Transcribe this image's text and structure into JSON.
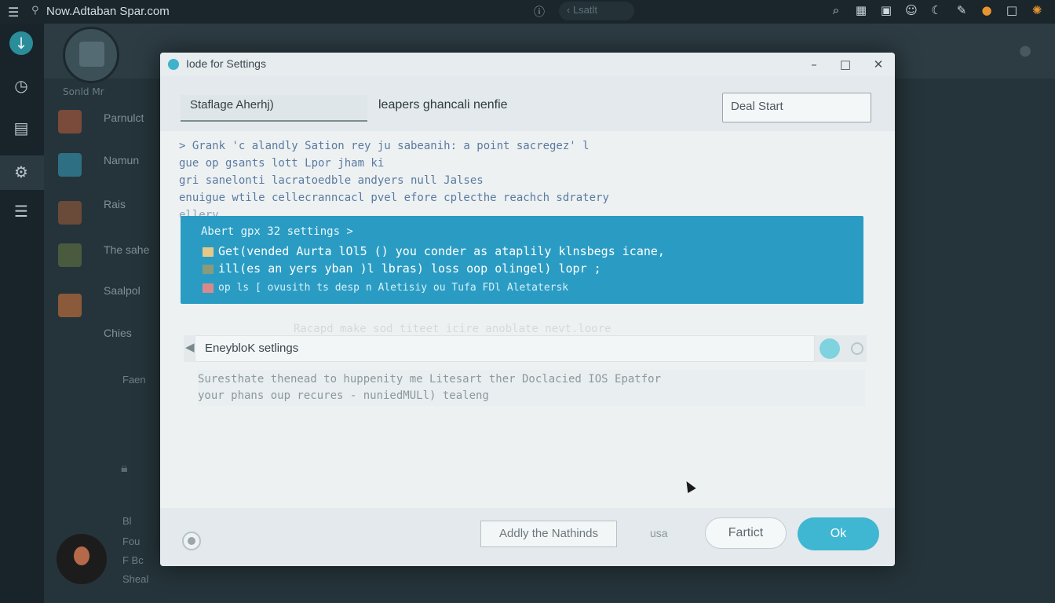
{
  "topbar": {
    "title": "Now.Adtaban Spar.com",
    "back_label": "Lsatlt",
    "icons": [
      "menu-icon",
      "pin-icon",
      "info-icon",
      "search-icon",
      "grid-icon",
      "lock-icon",
      "smile-icon",
      "moon-icon",
      "brush-icon",
      "avatar-icon",
      "square-icon",
      "logo-icon"
    ]
  },
  "rail": {
    "icons": [
      "download-icon",
      "clock-icon",
      "book-icon",
      "tools-icon",
      "list-icon"
    ]
  },
  "background_app": {
    "subtitle": "Sonld Mr",
    "list": [
      "Parnulct",
      "Namun",
      "Rais",
      "The sahe",
      "Saalpol",
      "Chies"
    ],
    "side_notes": [
      "Bl",
      "Fou",
      "F Bc",
      "Sheal"
    ],
    "misc_note": "Faen"
  },
  "dialog": {
    "title": "Iode for Settings",
    "tabs": [
      "Staflage Aherhj)",
      "leapers ghancali nenfie"
    ],
    "search_value": "Deal Start",
    "description": [
      "> Grank 'c alandly Sation rey ju sabeanih: a point sacregez' l",
      "gue op gsants lott Lpor jham ki",
      "gri sanelonti lacratoedble andyers null Jalses",
      "enuigue wtile cellecranncacl pvel efore cplecthe reachch sdratery",
      "ellery"
    ],
    "banner": {
      "heading": "Abert gpx 32 settings >",
      "lines": [
        "Get(vended Aurta lOl5 () you conder as ataplily klnsbegs icane,",
        "ill(es an yers yban )l lbras) loss oop olingel) lopr ;",
        "op ls [ ovusith ts desp n Aletisiy ou Tufa  FDl  Aletatersk"
      ]
    },
    "ghost_hint": "Racapd make sod titeet icire anoblate nevt.loore",
    "setting": {
      "label": "EneybloK setlings"
    },
    "help": [
      "Suresthate thenead to huppenity me Litesart ther Doclacied IOS Epatfor",
      "your phans oup recures - nuniedMULl) tealeng"
    ],
    "footer": {
      "additional_label": "Addly the Nathinds",
      "small_label": "usa",
      "cancel_label": "Fartict",
      "ok_label": "Ok"
    }
  }
}
